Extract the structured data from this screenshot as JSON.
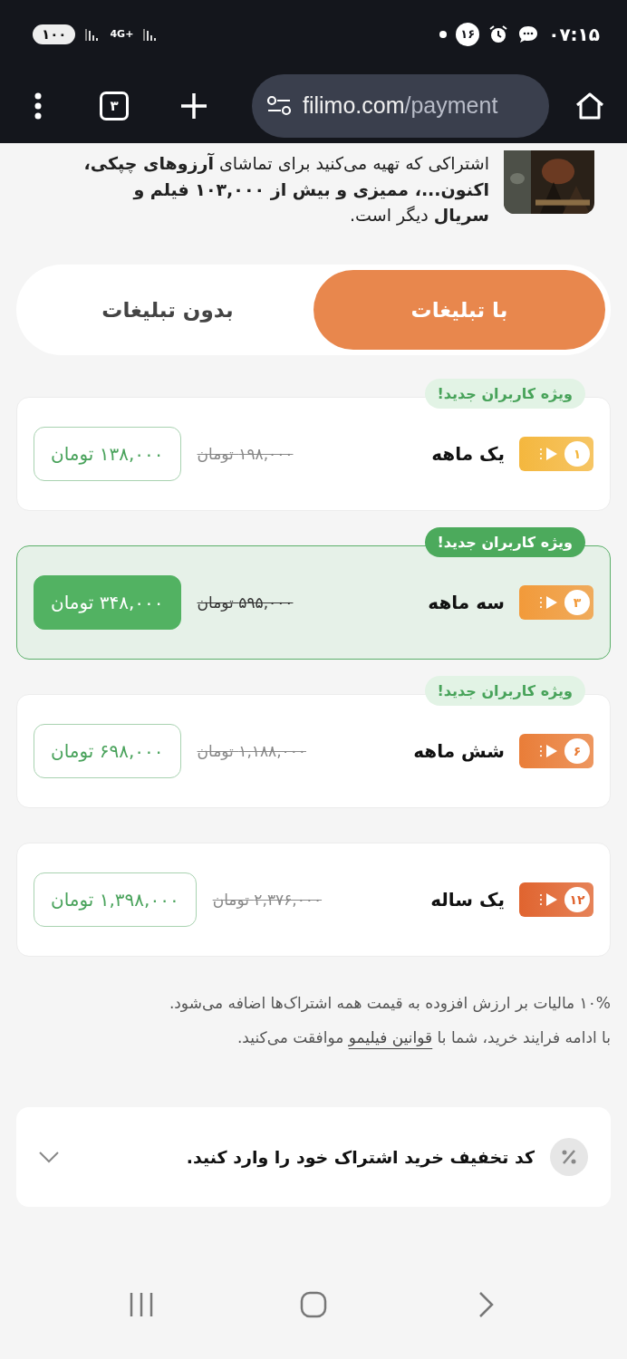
{
  "status_bar": {
    "battery": "۱۰۰",
    "network": "4G+",
    "notification_count": "۱۶",
    "time": "۰۷:۱۵"
  },
  "browser": {
    "tab_count": "۳",
    "url_host": "filimo.com",
    "url_path": "/payment"
  },
  "intro": {
    "kind": "picture",
    "text": "اشتراکی که تهیه می‌کنید برای تماشای **آرزوهای چپکی، اکنون...، ممیزی و بیش از ۱۰۳,۰۰۰ فیلم و سریال** دیگر است."
  },
  "plan_tabs": [
    {
      "label": "با تبلیغات",
      "selected": true
    },
    {
      "label": "بدون تبلیغات",
      "selected": false
    }
  ],
  "plans": [
    {
      "badge": "ویژه کاربران جدید!",
      "months": "۱",
      "name": "یک ماهه",
      "old_price": "۱۹۸,۰۰۰ تومان",
      "price": "۱۳۸,۰۰۰ تومان",
      "color": "#f4b73e",
      "selected": false
    },
    {
      "badge": "ویژه کاربران جدید!",
      "months": "۳",
      "name": "سه ماهه",
      "old_price": "۵۹۵,۰۰۰ تومان",
      "price": "۳۴۸,۰۰۰ تومان",
      "color": "#f29a3a",
      "selected": true
    },
    {
      "badge": "ویژه کاربران جدید!",
      "months": "۶",
      "name": "شش ماهه",
      "old_price": "۱,۱۸۸,۰۰۰ تومان",
      "price": "۶۹۸,۰۰۰ تومان",
      "color": "#e97d38",
      "selected": false
    },
    {
      "months": "۱۲",
      "name": "یک ساله",
      "old_price": "۲,۳۷۶,۰۰۰ تومان",
      "price": "۱,۳۹۸,۰۰۰ تومان",
      "color": "#e0642f",
      "selected": false
    }
  ],
  "notes": {
    "tax": "۱۰% مالیات بر ارزش افزوده به قیمت همه اشتراک‌ها اضافه می‌شود.",
    "terms_before": "با ادامه فرایند خرید، شما با",
    "terms_link": "قوانین فیلیمو",
    "terms_after": "موافقت می‌کنید."
  },
  "discount": {
    "label": "کد تخفیف خرید اشتراک خود را وارد کنید.",
    "expanded": false
  }
}
